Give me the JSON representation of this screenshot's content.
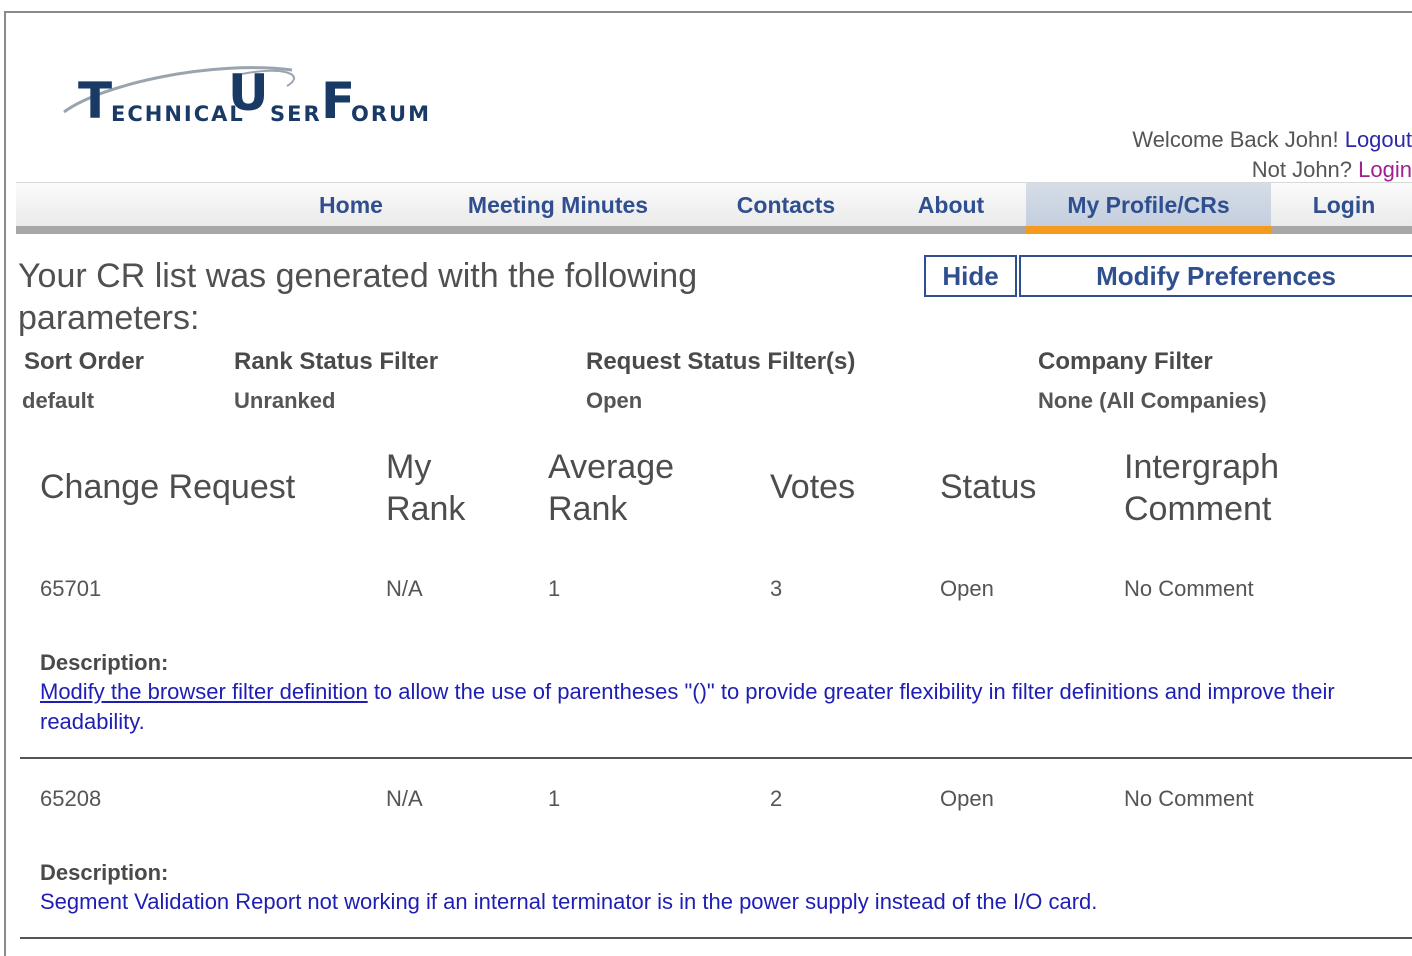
{
  "logo": {
    "letter_t": "T",
    "word_technical": "ECHNICAL",
    "letter_u": "U",
    "word_ser": "SER",
    "letter_f": "F",
    "word_orum": "ORUM"
  },
  "header": {
    "welcome_text": "Welcome Back John!",
    "logout_link": "Logout",
    "not_user_text": "Not John?",
    "login_link": "Login"
  },
  "nav": {
    "items": [
      {
        "label": "Home"
      },
      {
        "label": "Meeting Minutes"
      },
      {
        "label": "Contacts"
      },
      {
        "label": "About"
      },
      {
        "label": "My Profile/CRs",
        "active": true
      },
      {
        "label": "Login"
      }
    ],
    "active_color": "#f59a1e"
  },
  "params": {
    "title": "Your CR list was generated with the following parameters:",
    "hide_button": "Hide",
    "modify_button": "Modify Preferences",
    "headers": {
      "sort_order": "Sort Order",
      "rank_status": "Rank Status Filter",
      "request_status": "Request Status Filter(s)",
      "company": "Company Filter"
    },
    "values": {
      "sort_order": "default",
      "rank_status": "Unranked",
      "request_status": "Open",
      "company": "None (All Companies)"
    }
  },
  "table": {
    "headers": {
      "change_request": "Change Request",
      "my_rank_1": "My",
      "my_rank_2": "Rank",
      "avg_rank_1": "Average",
      "avg_rank_2": "Rank",
      "votes": "Votes",
      "status": "Status",
      "comment_1": "Intergraph",
      "comment_2": "Comment"
    },
    "description_label": "Description:",
    "rows": [
      {
        "id": "65701",
        "my_rank": "N/A",
        "average_rank": "1",
        "votes": "3",
        "status": "Open",
        "comment": "No Comment",
        "description_link": "Modify the browser filter definition",
        "description_rest": " to allow the use of parentheses \"()\" to provide greater flexibility in filter definitions and improve their readability."
      },
      {
        "id": "65208",
        "my_rank": "N/A",
        "average_rank": "1",
        "votes": "2",
        "status": "Open",
        "comment": "No Comment",
        "description_link": "",
        "description_rest": "Segment Validation Report not working if an internal terminator is in the power supply instead of the I/O card."
      }
    ]
  }
}
